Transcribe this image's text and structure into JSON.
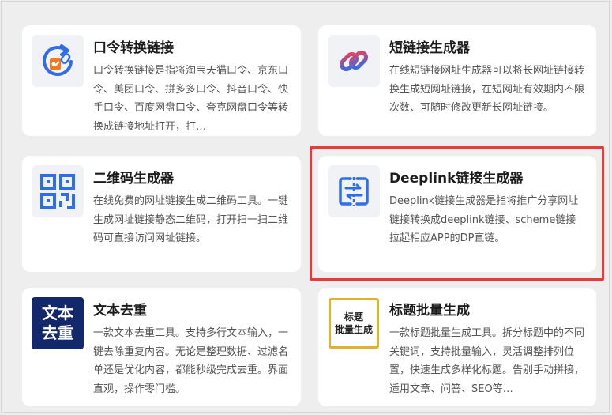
{
  "cards": [
    {
      "title": "口令转换链接",
      "desc": "口令转换链接是指将淘宝天猫口令、京东口令、美团口令、拼多多口令、抖音口令、快手口令、百度网盘口令、夸克网盘口令等转换成链接地址打开，打…",
      "icon": "refresh-link-icon"
    },
    {
      "title": "短链接生成器",
      "desc": "在线短链接网址生成器可以将长网址链接转换生成短网址链接，在短网址有效期内不限次数、可随时修改更新长网址链接。",
      "icon": "chain-link-icon"
    },
    {
      "title": "二维码生成器",
      "desc": "在线免费的网址链接生成二维码工具。一键生成网址链接静态二维码，打开扫一扫二维码可直接访问网址链接。",
      "icon": "qr-code-icon"
    },
    {
      "title": "Deeplink链接生成器",
      "desc": "Deeplink链接生成器是指将推广分享网址链接转换成deeplink链接、scheme链接拉起相应APP的DP直链。",
      "icon": "deeplink-icon"
    },
    {
      "title": "文本去重",
      "desc": "一款文本去重工具。支持多行文本输入，一键去除重复内容。无论是整理数据、过滤名单还是优化内容，都能秒级完成去重。界面直观，操作零门槛。",
      "icon": "text-dedupe-icon",
      "icon_text": [
        "文本",
        "去重"
      ]
    },
    {
      "title": "标题批量生成",
      "desc": "一款标题批量生成工具。拆分标题中的不同关键词，支持批量输入，灵活调整排列位置，快速生成多样化标题。告别手动拼接，适用文章、问答、SEO等…",
      "icon": "title-generator-icon",
      "icon_text": [
        "标题",
        "批量生成"
      ]
    }
  ],
  "colors": {
    "accent_blue": "#2f6ee8",
    "highlight_red": "#e63b3b",
    "title_icon_border": "#e0b32c",
    "text_icon_bg": "#13286a"
  }
}
